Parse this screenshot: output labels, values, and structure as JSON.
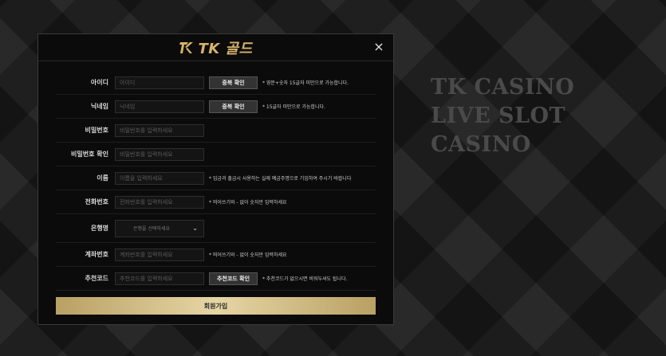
{
  "background": {
    "line1": "TK CASINO",
    "line2": "LIVE SLOT CASINO"
  },
  "modal": {
    "logo": "TK 골드",
    "close": "×",
    "submit_label": "회원가입",
    "accent": "#d7b36a",
    "fields": {
      "id": {
        "label": "아이디",
        "placeholder": "아이디",
        "button": "중복 확인",
        "hint": "* 영문+숫자 15글자 미만으로 가능합니다."
      },
      "nickname": {
        "label": "닉네임",
        "placeholder": "닉네임",
        "button": "중복 확인",
        "hint": "* 15글자 미만으로 가능합니다."
      },
      "password": {
        "label": "비밀번호",
        "placeholder": "비밀번호를 입력하세요"
      },
      "password_confirm": {
        "label": "비밀번호 확인",
        "placeholder": "비밀번호를 입력하세요"
      },
      "name": {
        "label": "이름",
        "placeholder": "이름을 입력하세요",
        "hint": "* 입금과 출금시 사용하는 실제 예금주명으로 기입하여 주시기 바랍니다"
      },
      "phone": {
        "label": "전화번호",
        "placeholder": "전화번호를 입력하세요",
        "hint": "* 띄어쓰기와 - 없이 숫자만 입력하세요"
      },
      "bank": {
        "label": "은행명",
        "selected": "은행을 선택하세요"
      },
      "account": {
        "label": "계좌번호",
        "placeholder": "계좌번호를 입력하세요",
        "hint": "* 띄어쓰기와 - 없이 숫자만 입력하세요"
      },
      "referral": {
        "label": "추천코드",
        "placeholder": "추천코드를 입력하세요",
        "button": "추천코드 확인",
        "hint": "* 추천코드가 없으시면 비워두셔도 됩니다."
      }
    }
  }
}
